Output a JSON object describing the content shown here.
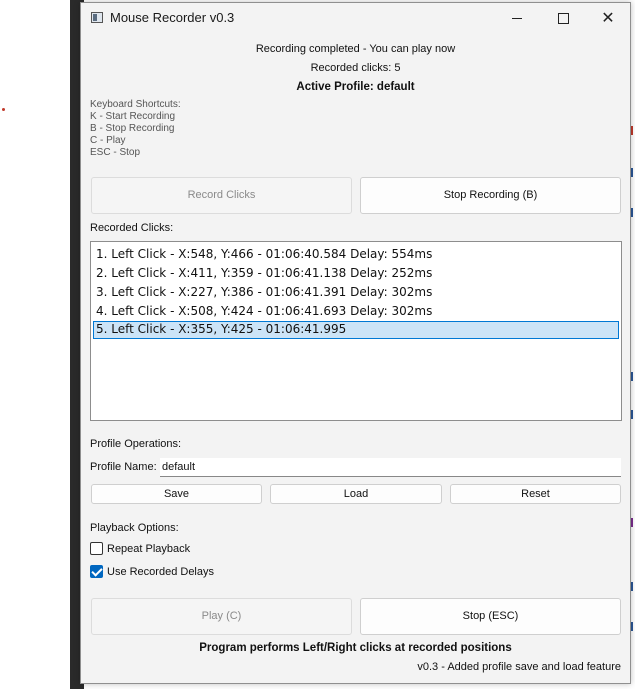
{
  "window": {
    "title": "Mouse Recorder v0.3"
  },
  "status": {
    "message": "Recording completed - You can play now",
    "recorded_count": "Recorded clicks: 5",
    "active_profile": "Active Profile: default"
  },
  "shortcuts": {
    "title": "Keyboard Shortcuts:",
    "items": [
      "K - Start Recording",
      "B - Stop Recording",
      "C - Play",
      "ESC - Stop"
    ]
  },
  "record": {
    "record_label": "Record Clicks",
    "stop_label": "Stop Recording (B)"
  },
  "clicks": {
    "title": "Recorded Clicks:",
    "items": [
      "1. Left Click - X:548, Y:466 - 01:06:40.584 Delay: 554ms",
      "2. Left Click - X:411, Y:359 - 01:06:41.138 Delay: 252ms",
      "3. Left Click - X:227, Y:386 - 01:06:41.391 Delay: 302ms",
      "4. Left Click - X:508, Y:424 - 01:06:41.693 Delay: 302ms",
      "5. Left Click - X:355, Y:425 - 01:06:41.995"
    ],
    "selected_index": 4
  },
  "profile": {
    "title": "Profile Operations:",
    "name_label": "Profile Name:",
    "name_value": "default",
    "save_label": "Save",
    "load_label": "Load",
    "reset_label": "Reset"
  },
  "playback": {
    "title": "Playback Options:",
    "repeat_label": "Repeat Playback",
    "repeat_checked": false,
    "delays_label": "Use Recorded Delays",
    "delays_checked": true,
    "play_label": "Play (C)",
    "stop_label": "Stop (ESC)"
  },
  "footer": {
    "info": "Program performs Left/Right clicks at recorded positions",
    "version": "v0.3 - Added profile save and load feature"
  },
  "icons": {
    "minimize": "minimize-icon",
    "maximize": "maximize-icon",
    "close": "close-icon",
    "app": "app-icon"
  },
  "colors": {
    "accent": "#0067c0",
    "selection": "#cce4f7"
  }
}
